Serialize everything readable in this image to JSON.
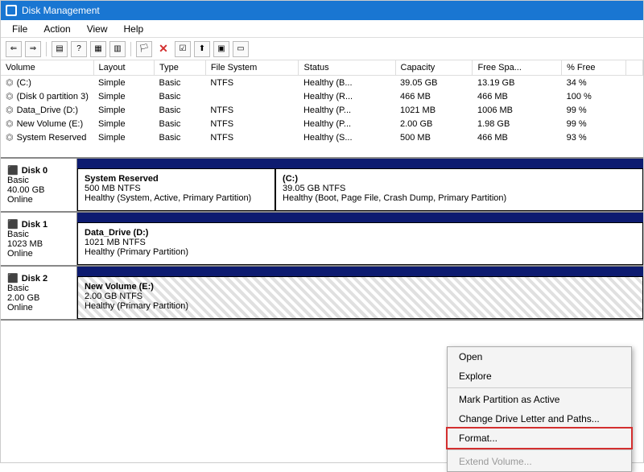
{
  "title": "Disk Management",
  "menu": [
    "File",
    "Action",
    "View",
    "Help"
  ],
  "columns": [
    "Volume",
    "Layout",
    "Type",
    "File System",
    "Status",
    "Capacity",
    "Free Spa...",
    "% Free"
  ],
  "volumes": [
    {
      "name": "(C:)",
      "layout": "Simple",
      "type": "Basic",
      "fs": "NTFS",
      "status": "Healthy (B...",
      "cap": "39.05 GB",
      "free": "13.19 GB",
      "pct": "34 %"
    },
    {
      "name": "(Disk 0 partition 3)",
      "layout": "Simple",
      "type": "Basic",
      "fs": "",
      "status": "Healthy (R...",
      "cap": "466 MB",
      "free": "466 MB",
      "pct": "100 %"
    },
    {
      "name": "Data_Drive (D:)",
      "layout": "Simple",
      "type": "Basic",
      "fs": "NTFS",
      "status": "Healthy (P...",
      "cap": "1021 MB",
      "free": "1006 MB",
      "pct": "99 %"
    },
    {
      "name": "New Volume (E:)",
      "layout": "Simple",
      "type": "Basic",
      "fs": "NTFS",
      "status": "Healthy (P...",
      "cap": "2.00 GB",
      "free": "1.98 GB",
      "pct": "99 %"
    },
    {
      "name": "System Reserved",
      "layout": "Simple",
      "type": "Basic",
      "fs": "NTFS",
      "status": "Healthy (S...",
      "cap": "500 MB",
      "free": "466 MB",
      "pct": "93 %"
    }
  ],
  "disks": [
    {
      "name": "Disk 0",
      "kind": "Basic",
      "size": "40.00 GB",
      "state": "Online",
      "parts": [
        {
          "title": "System Reserved",
          "sub": "500 MB NTFS",
          "stat": "Healthy (System, Active, Primary Partition)",
          "w": "35%"
        },
        {
          "title": "(C:)",
          "sub": "39.05 GB NTFS",
          "stat": "Healthy (Boot, Page File, Crash Dump, Primary Partition)",
          "w": "65%"
        }
      ]
    },
    {
      "name": "Disk 1",
      "kind": "Basic",
      "size": "1023 MB",
      "state": "Online",
      "parts": [
        {
          "title": "Data_Drive  (D:)",
          "sub": "1021 MB NTFS",
          "stat": "Healthy (Primary Partition)",
          "w": "100%"
        }
      ]
    },
    {
      "name": "Disk 2",
      "kind": "Basic",
      "size": "2.00 GB",
      "state": "Online",
      "parts": [
        {
          "title": "New Volume  (E:)",
          "sub": "2.00 GB NTFS",
          "stat": "Healthy (Primary Partition)",
          "w": "100%",
          "hatched": true
        }
      ]
    }
  ],
  "ctx": {
    "open": "Open",
    "explore": "Explore",
    "mark": "Mark Partition as Active",
    "change": "Change Drive Letter and Paths...",
    "format": "Format...",
    "extend": "Extend Volume..."
  }
}
